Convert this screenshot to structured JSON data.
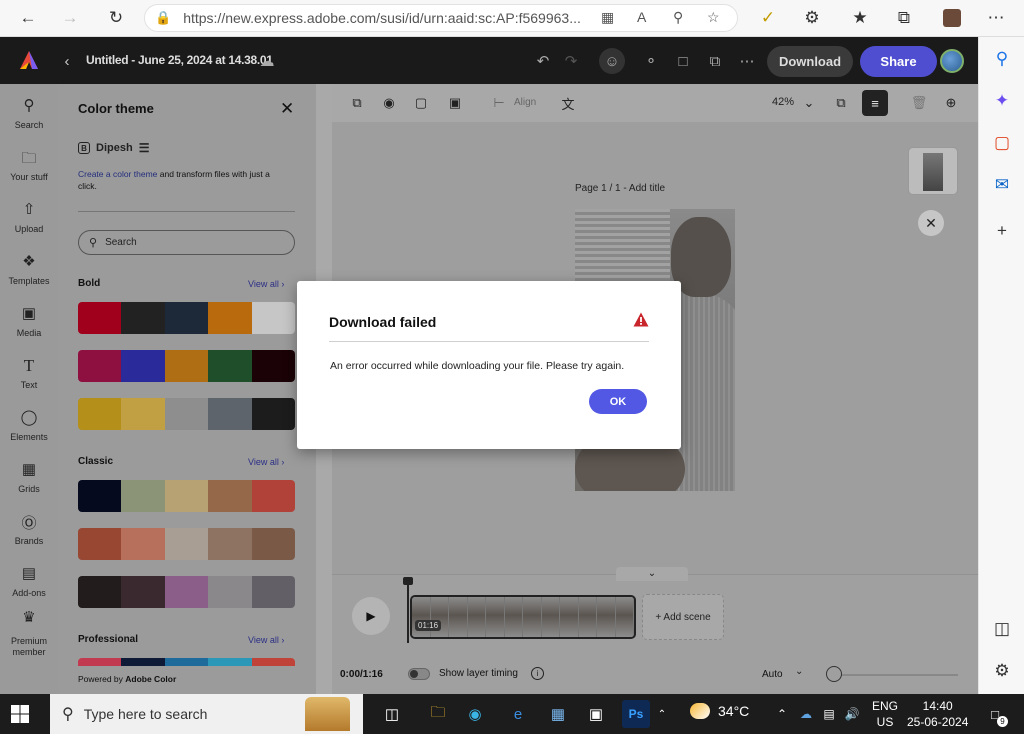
{
  "browser": {
    "url": "https://new.express.adobe.com/susi/id/urn:aaid:sc:AP:f569963..."
  },
  "app": {
    "doc_title": "Untitled - June 25, 2024 at 14.38.01",
    "download_label": "Download",
    "share_label": "Share"
  },
  "rail": {
    "items": [
      {
        "label": "Search",
        "icon": "search-icon"
      },
      {
        "label": "Your stuff",
        "icon": "folder-icon"
      },
      {
        "label": "Upload",
        "icon": "upload-icon"
      },
      {
        "label": "Templates",
        "icon": "templates-icon"
      },
      {
        "label": "Media",
        "icon": "media-icon"
      },
      {
        "label": "Text",
        "icon": "text-icon"
      },
      {
        "label": "Elements",
        "icon": "elements-icon"
      },
      {
        "label": "Grids",
        "icon": "grids-icon"
      },
      {
        "label": "Brands",
        "icon": "brands-icon"
      },
      {
        "label": "Add-ons",
        "icon": "addons-icon"
      },
      {
        "label": "Premium member",
        "icon": "premium-icon"
      }
    ]
  },
  "panel": {
    "title": "Color theme",
    "brand_name": "Dipesh",
    "desc_link": "Create a color theme",
    "desc_rest": " and transform files with just a click.",
    "search_placeholder": "Search",
    "view_all": "View all",
    "footer_prefix": "Powered by ",
    "footer_brand": "Adobe Color",
    "sections": [
      {
        "title": "Bold",
        "palettes": [
          [
            "#a0001c",
            "#222222",
            "#1d2838",
            "#b86a0c",
            "#c6c6c6"
          ],
          [
            "#8e1040",
            "#2a2a9a",
            "#b06e14",
            "#1e4f2a",
            "#1a0206"
          ],
          [
            "#b4901a",
            "#c0a042",
            "#8e8e8e",
            "#5e646c",
            "#1c1c1c"
          ]
        ]
      },
      {
        "title": "Classic",
        "palettes": [
          [
            "#060a1e",
            "#8c9478",
            "#b6a272",
            "#96684a",
            "#b0423a"
          ],
          [
            "#984832",
            "#b6705c",
            "#a89e94",
            "#8e7262",
            "#7a5a46"
          ],
          [
            "#221c1c",
            "#3a2a30",
            "#8a5e88",
            "#8a888a",
            "#626066"
          ]
        ]
      },
      {
        "title": "Professional",
        "palettes": [
          [
            "#c23a50",
            "#0e1a36",
            "#1e6a9a",
            "#2c98b8",
            "#c0433a"
          ]
        ]
      }
    ]
  },
  "canvas": {
    "align_label": "Align",
    "zoom": "42%",
    "page_label": "Page 1 / 1 - Add title"
  },
  "timeline": {
    "clip_duration": "01:16",
    "add_scene": "+ Add scene",
    "time": "0:00/1:16",
    "layer_timing": "Show layer timing",
    "auto": "Auto"
  },
  "modal": {
    "title": "Download failed",
    "message": "An error occurred while downloading your file. Please try again.",
    "ok": "OK",
    "alert_color": "#c9252c",
    "ok_color": "#5258e4"
  },
  "taskbar": {
    "search_placeholder": "Type here to search",
    "temperature": "34°C",
    "lang": "ENG",
    "region": "US",
    "time": "14:40",
    "date": "25-06-2024",
    "notifications": "9"
  }
}
